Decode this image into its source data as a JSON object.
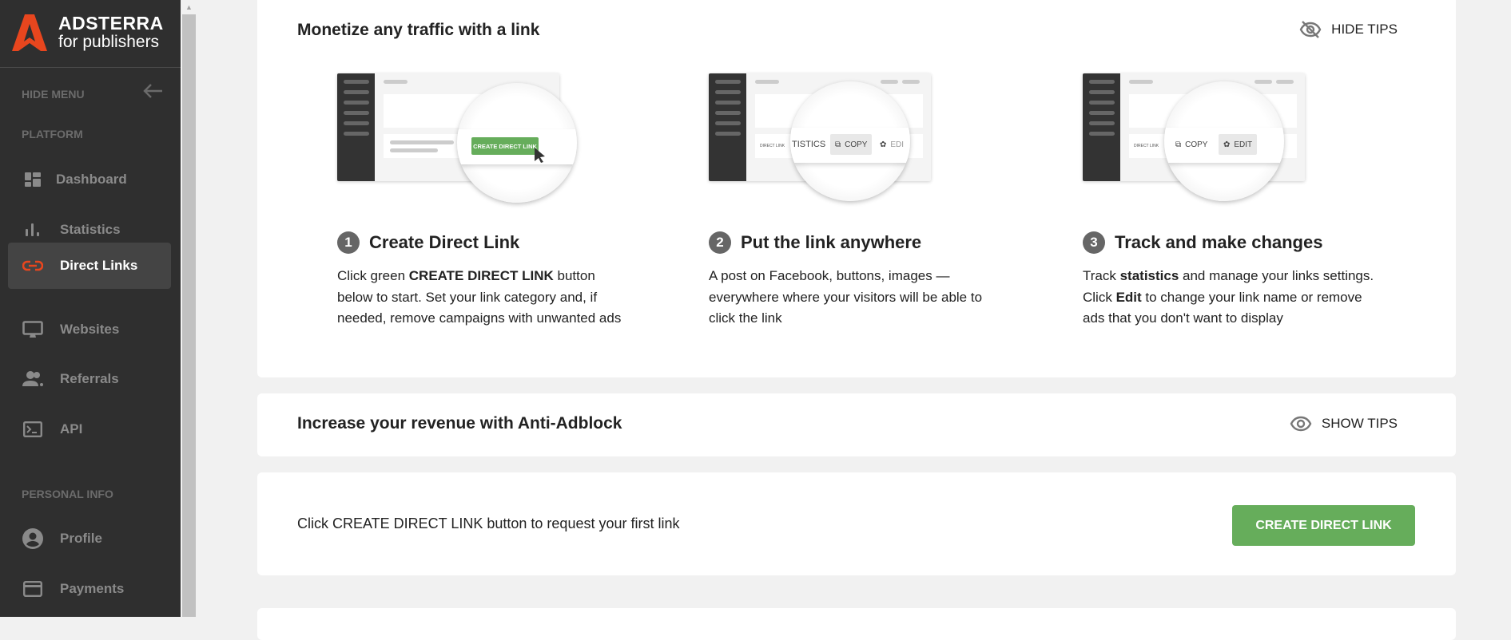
{
  "brand": {
    "name": "ADSTERRA",
    "tagline": "for publishers",
    "accent": "#e8461e"
  },
  "sidebar": {
    "hide_menu": "HIDE MENU",
    "section_platform": "PLATFORM",
    "section_personal": "PERSONAL INFO",
    "items": [
      {
        "label": "Dashboard",
        "icon": "dashboard-icon"
      },
      {
        "label": "Statistics",
        "icon": "bar-chart-icon"
      },
      {
        "label": "Direct Links",
        "icon": "link-icon",
        "active": true
      },
      {
        "label": "Websites",
        "icon": "monitor-icon"
      },
      {
        "label": "Referrals",
        "icon": "people-icon"
      },
      {
        "label": "API",
        "icon": "terminal-icon"
      },
      {
        "label": "Profile",
        "icon": "account-circle-icon"
      },
      {
        "label": "Payments",
        "icon": "credit-card-icon"
      }
    ]
  },
  "tips_card": {
    "title": "Monetize any traffic with a link",
    "hide_tips": "HIDE TIPS",
    "steps": [
      {
        "num": "1",
        "title": "Create Direct Link",
        "desc_pre": "Click green ",
        "desc_bold": "CREATE DIRECT LINK",
        "desc_post": " button below to start. Set your link category and, if needed, remove campaigns with unwanted ads",
        "illu": {
          "button": "CREATE DIRECT LINK"
        }
      },
      {
        "num": "2",
        "title": "Put the link anywhere",
        "desc": "A post on Facebook, buttons, images — everywhere where your visitors will be able to click the link",
        "illu": {
          "label": "DIRECT LINK",
          "a": "TISTICS",
          "b": "COPY",
          "c": "EDI"
        }
      },
      {
        "num": "3",
        "title": "Track and make changes",
        "desc_a": "Track ",
        "desc_b": "statistics",
        "desc_c": " and manage your links settings. Click ",
        "desc_d": "Edit",
        "desc_e": " to change your link name or remove ads that you don't want to display",
        "illu": {
          "label": "DIRECT LINK",
          "a": "COPY",
          "b": "EDIT"
        }
      }
    ]
  },
  "adblock_card": {
    "title": "Increase your revenue with Anti-Adblock",
    "show_tips": "SHOW TIPS"
  },
  "create_card": {
    "text": "Click CREATE DIRECT LINK button to request your first link",
    "button": "CREATE DIRECT LINK",
    "button_color": "#66ad5b"
  }
}
